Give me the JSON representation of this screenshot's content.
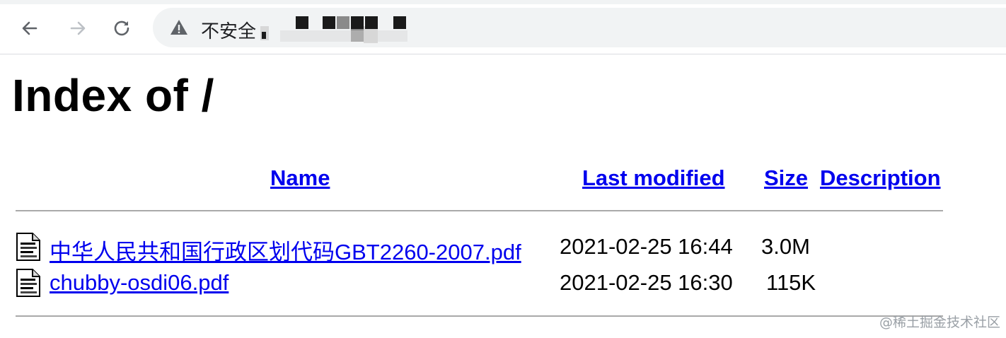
{
  "browser": {
    "security_label": "不安全"
  },
  "page": {
    "title": "Index of /",
    "columns": [
      "Name",
      "Last modified",
      "Size",
      "Description"
    ],
    "files": [
      {
        "name": "中华人民共和国行政区划代码GBT2260-2007.pdf",
        "modified": "2021-02-25 16:44",
        "size": "3.0M",
        "description": ""
      },
      {
        "name": "chubby-osdi06.pdf",
        "modified": "2021-02-25 16:30",
        "size": "115K",
        "description": ""
      }
    ]
  },
  "watermark": "@稀土掘金技术社区"
}
